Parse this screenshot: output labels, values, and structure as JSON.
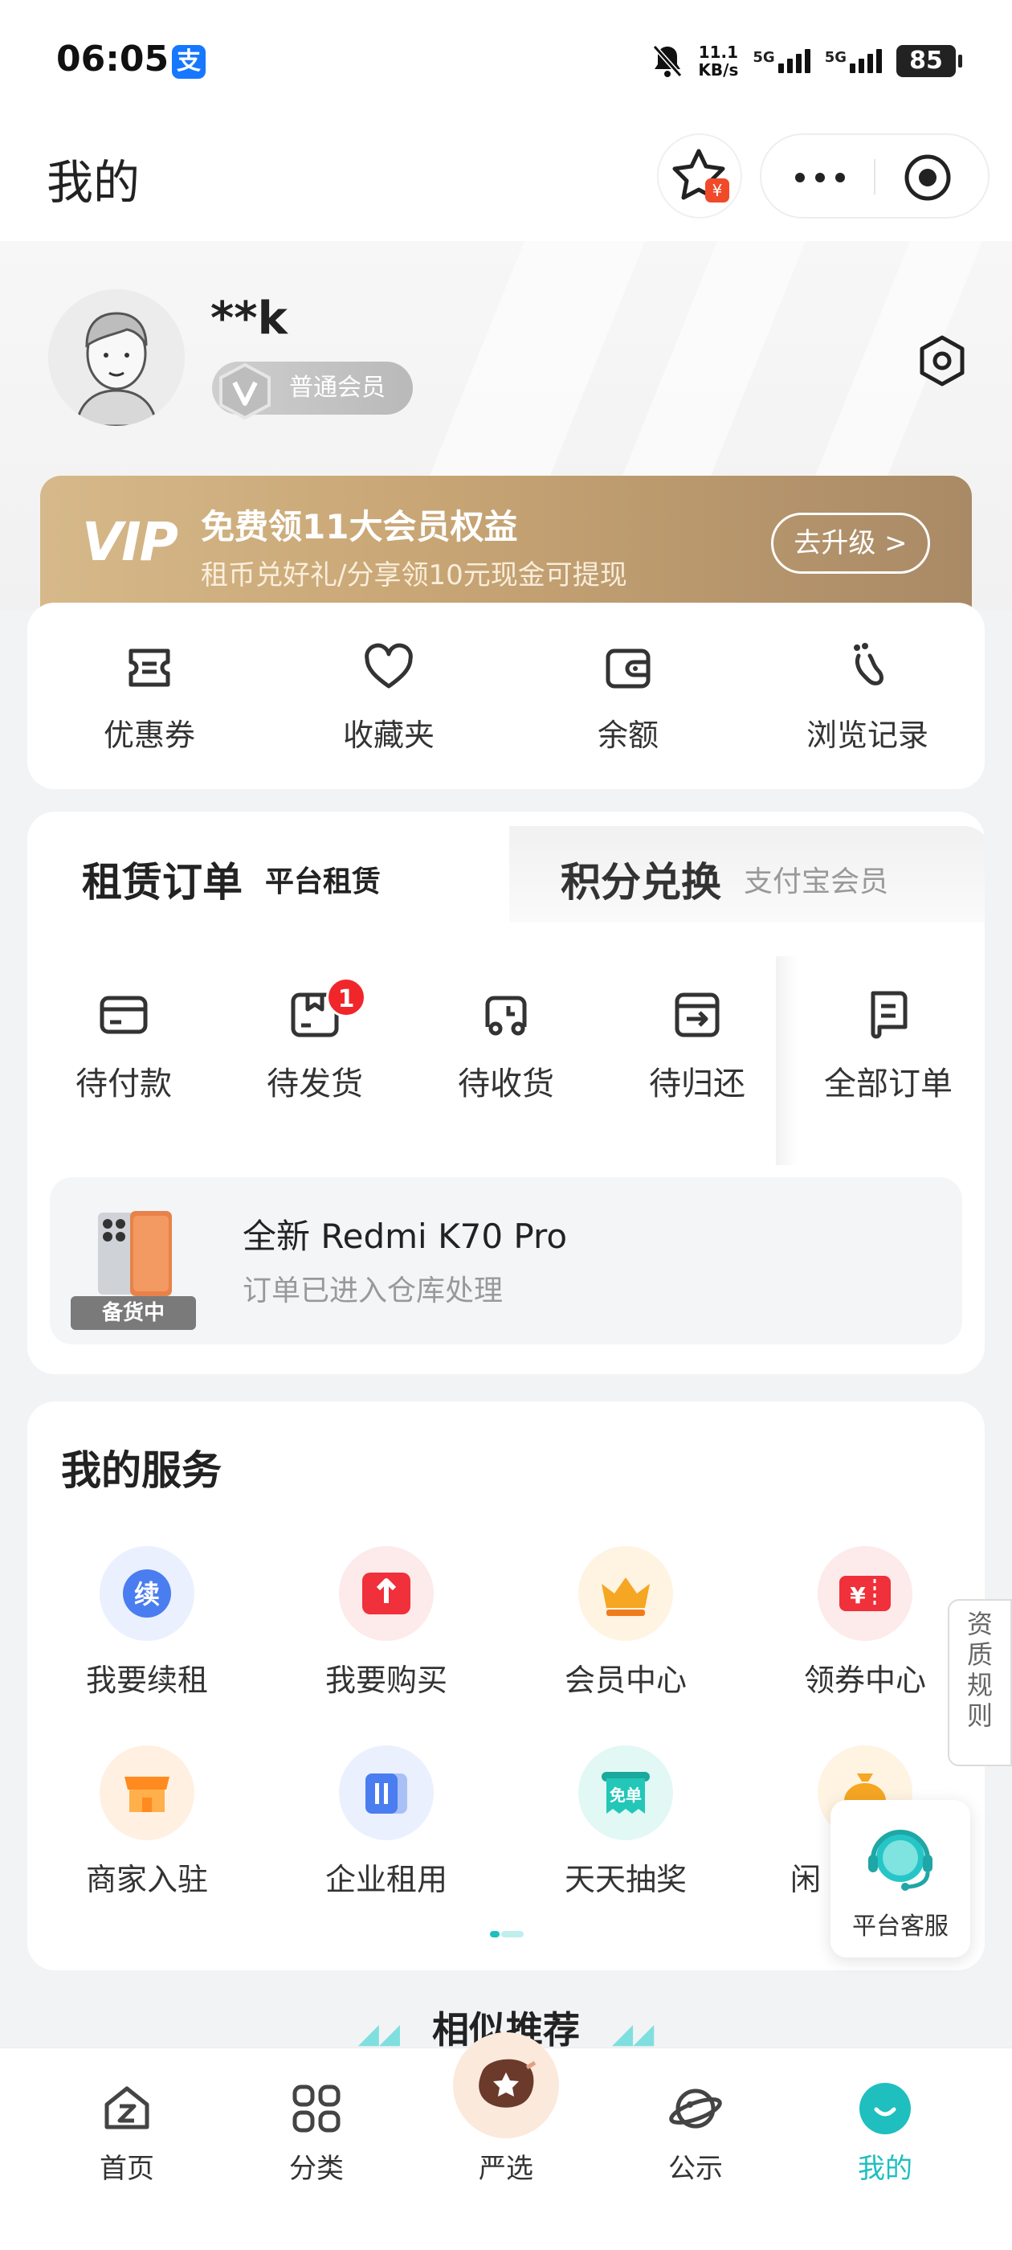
{
  "status_bar": {
    "time": "06:05",
    "alipay_glyph": "支",
    "speed_value": "11.1",
    "speed_unit": "KB/s",
    "sim1": "5G",
    "sim2": "5G",
    "battery": "85"
  },
  "header": {
    "title": "我的",
    "favorite_badge": "¥"
  },
  "profile": {
    "username": "**k",
    "member_level": "普通会员"
  },
  "vip_banner": {
    "logo": "VIP",
    "title": "免费领11大会员权益",
    "subtitle": "租币兑好礼/分享领10元现金可提现",
    "button": "去升级 >"
  },
  "quick_actions": [
    {
      "label": "优惠券",
      "icon": "coupon-icon"
    },
    {
      "label": "收藏夹",
      "icon": "heart-icon"
    },
    {
      "label": "余额",
      "icon": "wallet-icon"
    },
    {
      "label": "浏览记录",
      "icon": "footprint-icon"
    }
  ],
  "orders": {
    "tab_active": "租赁订单",
    "tab_active_sub": "平台租赁",
    "tab_other": "积分兑换",
    "tab_other_sub": "支付宝会员",
    "items": [
      {
        "label": "待付款",
        "icon": "card-icon"
      },
      {
        "label": "待发货",
        "icon": "package-icon",
        "badge": "1"
      },
      {
        "label": "待收货",
        "icon": "truck-clock-icon"
      },
      {
        "label": "待归还",
        "icon": "return-icon"
      },
      {
        "label": "全部订单",
        "icon": "document-icon"
      }
    ],
    "recent": {
      "product": "全新 Redmi K70 Pro",
      "status": "订单已进入仓库处理",
      "tag": "备货中"
    }
  },
  "services": {
    "title": "我的服务",
    "items": [
      {
        "label": "我要续租",
        "icon": "renew-icon",
        "glyph": "续",
        "color": "#4a7df0"
      },
      {
        "label": "我要购买",
        "icon": "buy-icon",
        "color": "#f0303a"
      },
      {
        "label": "会员中心",
        "icon": "crown-icon",
        "color": "#f5a623"
      },
      {
        "label": "领券中心",
        "icon": "ticket-icon",
        "glyph": "¥",
        "color": "#f0303a"
      },
      {
        "label": "商家入驻",
        "icon": "shop-icon",
        "color": "#ff8a1f"
      },
      {
        "label": "企业租用",
        "icon": "enterprise-icon",
        "color": "#4a7df0"
      },
      {
        "label": "天天抽奖",
        "icon": "lottery-icon",
        "glyph": "免单",
        "color": "#22c7b8"
      },
      {
        "label": "闲",
        "icon": "moneybag-icon",
        "color": "#f5a623"
      }
    ]
  },
  "side_tab": {
    "label": "资质规则"
  },
  "customer_service": {
    "label": "平台客服"
  },
  "similar": {
    "title": "相似推荐"
  },
  "tabbar": [
    {
      "label": "首页",
      "icon": "home-icon"
    },
    {
      "label": "分类",
      "icon": "category-icon"
    },
    {
      "label": "严选",
      "icon": "selection-icon"
    },
    {
      "label": "公示",
      "icon": "planet-icon"
    },
    {
      "label": "我的",
      "icon": "profile-icon",
      "active": true
    }
  ],
  "colors": {
    "accent": "#1fbfbf",
    "badge_red": "#f0262b",
    "vip_gold": "#c9a675"
  }
}
